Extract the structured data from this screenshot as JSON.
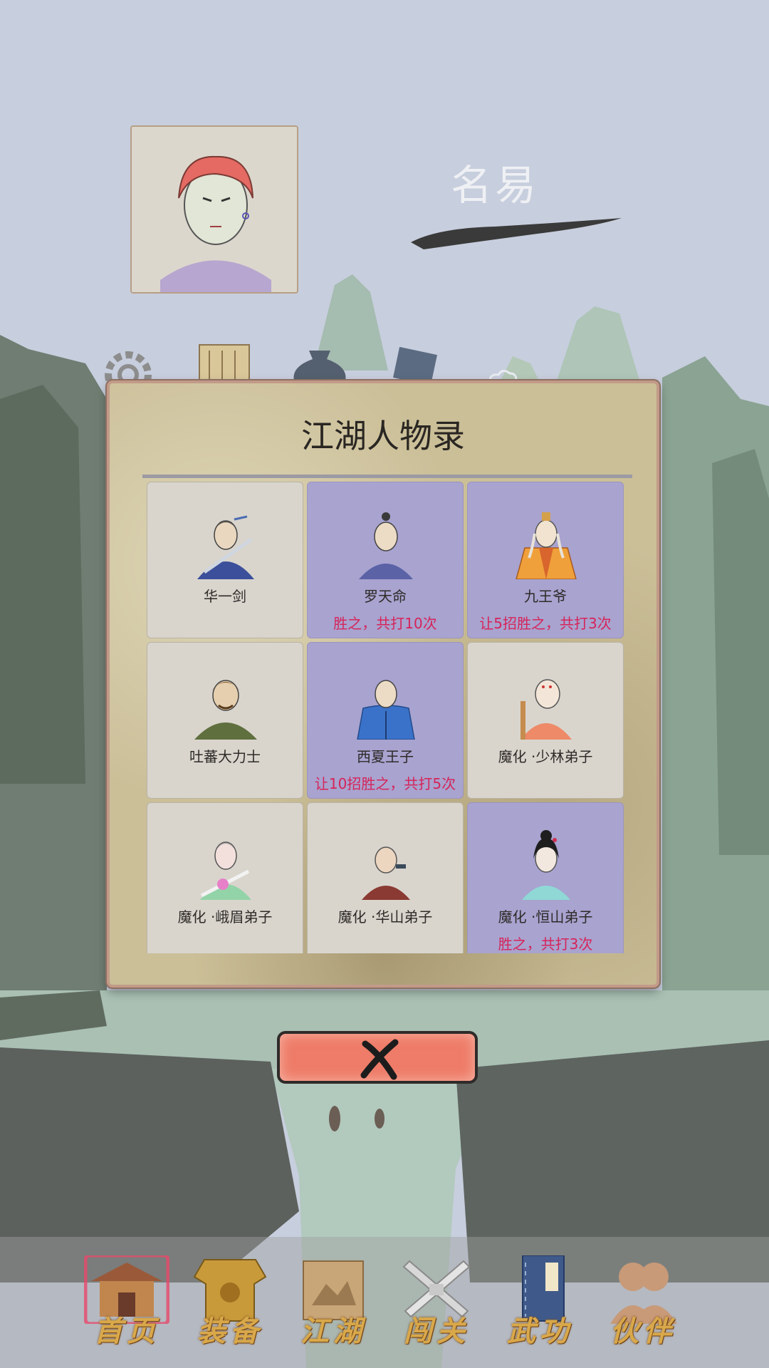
{
  "player": {
    "name": "名易"
  },
  "modal": {
    "title": "江湖人物录"
  },
  "characters": [
    {
      "name": "华一剑",
      "record": "",
      "defeated": false
    },
    {
      "name": "罗天命",
      "record": "胜之，共打10次",
      "defeated": true
    },
    {
      "name": "九王爷",
      "record": "让5招胜之，共打3次",
      "defeated": true
    },
    {
      "name": "吐蕃大力士",
      "record": "",
      "defeated": false
    },
    {
      "name": "西夏王子",
      "record": "让10招胜之，共打5次",
      "defeated": true
    },
    {
      "name": "魔化 ·少林弟子",
      "record": "",
      "defeated": false
    },
    {
      "name": "魔化 ·峨眉弟子",
      "record": "",
      "defeated": false
    },
    {
      "name": "魔化 ·华山弟子",
      "record": "",
      "defeated": false
    },
    {
      "name": "魔化 ·恒山弟子",
      "record": "胜之，共打3次",
      "defeated": true
    }
  ],
  "nav": [
    {
      "label": "首页",
      "icon": "palace-icon"
    },
    {
      "label": "装备",
      "icon": "armor-icon"
    },
    {
      "label": "江湖",
      "icon": "scroll-map-icon"
    },
    {
      "label": "闯关",
      "icon": "crossed-swords-icon"
    },
    {
      "label": "武功",
      "icon": "martial-book-icon"
    },
    {
      "label": "伙伴",
      "icon": "companions-icon"
    }
  ],
  "colors": {
    "card_defeated": "#a8a3cf",
    "card_normal": "#d9d5cd",
    "record_text": "#d6245a",
    "close_button": "#ee7c68",
    "nav_label": "#d8a84a"
  }
}
